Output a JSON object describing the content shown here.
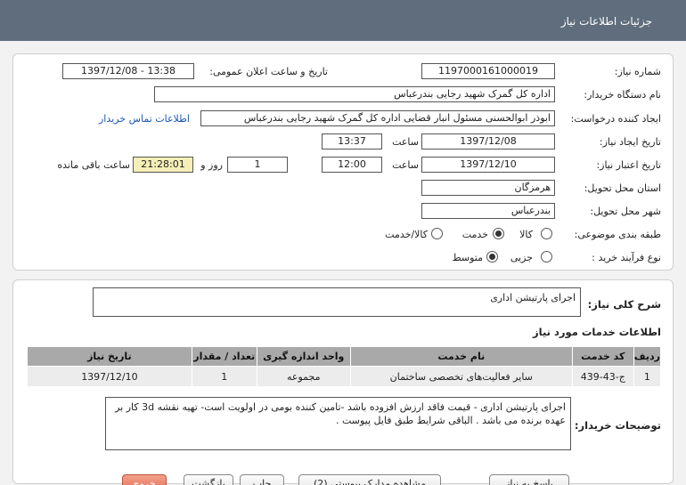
{
  "window": {
    "title": "جزئیات اطلاعات نیاز"
  },
  "form": {
    "need_number_label": "شماره نیاز:",
    "need_number": "1197000161000019",
    "announce_label": "تاریخ و ساعت اعلان عمومی:",
    "announce_value": "1397/12/08 - 13:38",
    "buyer_org_label": "نام دستگاه خریدار:",
    "buyer_org": "اداره کل گمرک شهید رجایی بندرعباس",
    "requester_label": "ایجاد کننده درخواست:",
    "requester": "ابوذر ابوالحسنی مسئول انبار قضایی اداره کل گمرک شهید رجایی بندرعباس",
    "contact_link": "اطلاعات تماس خریدار",
    "created_label": "تاریخ ایجاد نیاز:",
    "created_date": "1397/12/08",
    "time_label": "ساعت",
    "created_time": "13:37",
    "validity_label": "تاریخ اعتبار نیاز:",
    "validity_date": "1397/12/10",
    "validity_time": "12:00",
    "days_value": "1",
    "days_label": "روز و",
    "remaining_time": "21:28:01",
    "remaining_label": "ساعت باقی مانده",
    "province_label": "استان محل تحویل:",
    "province": "هرمزگان",
    "city_label": "شهر محل تحویل:",
    "city": "بندرعباس",
    "category_label": "طبقه بندی موضوعی:",
    "category_options": [
      {
        "label": "کالا",
        "selected": false
      },
      {
        "label": "خدمت",
        "selected": true
      },
      {
        "label": "کالا/خدمت",
        "selected": false
      }
    ],
    "process_label": "نوع فرآیند خرید :",
    "process_options": [
      {
        "label": "جزیی",
        "selected": false
      },
      {
        "label": "متوسط",
        "selected": true
      }
    ]
  },
  "summary": {
    "label": "شرح کلی نیاز:",
    "value": "اجرای پارتیشن اداری"
  },
  "services": {
    "heading": "اطلاعات خدمات مورد نیاز",
    "columns": [
      "ردیف",
      "کد خدمت",
      "نام خدمت",
      "واحد اندازه گیری",
      "تعداد / مقدار",
      "تاریخ نیاز"
    ],
    "rows": [
      [
        "1",
        "ج-43-439",
        "سایر فعالیت‌های تخصصی ساختمان",
        "مجموعه",
        "1",
        "1397/12/10"
      ]
    ]
  },
  "buyer_notes": {
    "label": "توضیحات خریدار:",
    "value": "اجرای پارتیشن اداری - قیمت فاقد ارزش افزوده باشد -تامین کننده بومی در اولویت است- تهیه نقشه 3d کار بر عهده برنده می باشد . الباقی شرایط طبق فایل پیوست ."
  },
  "buttons": {
    "reply": "پاسخ به نیاز",
    "view_docs": "مشاهده مدارک پیوستی (2)",
    "print": "چاپ",
    "back": "بازگشت",
    "exit": "خروج"
  }
}
